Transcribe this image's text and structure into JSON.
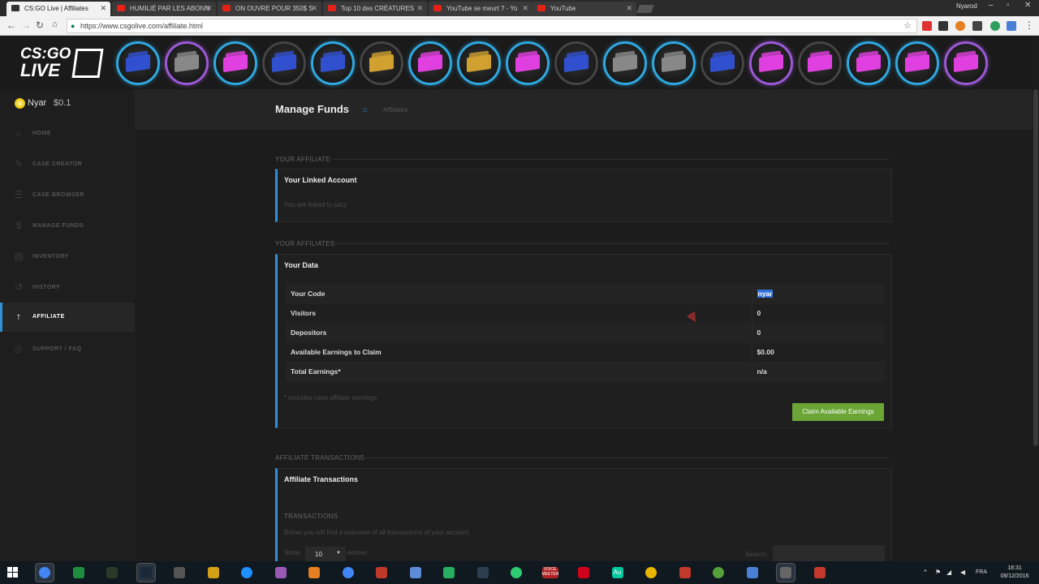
{
  "browser": {
    "tabs": [
      {
        "title": "CS:GO Live | Affiliates",
        "active": true
      },
      {
        "title": "HUMILIÉ PAR LES ABONN",
        "active": false
      },
      {
        "title": "ON OUVRE POUR 350$ S",
        "active": false
      },
      {
        "title": "Top 10 des CRÉATURES",
        "active": false
      },
      {
        "title": "YouTube se meurt ? - Yo",
        "active": false
      },
      {
        "title": "YouTube",
        "active": false
      }
    ],
    "window_user": "Nyarod",
    "url": "https://www.csgolive.com/affiliate.html"
  },
  "site": {
    "logo_line1": "CS:GO",
    "logo_line2": "LIVE",
    "cases": [
      {
        "ring": "blue",
        "color": "#3050d0"
      },
      {
        "ring": "purple",
        "color": "#888888"
      },
      {
        "ring": "blue",
        "color": "#e040e0"
      },
      {
        "ring": "gray",
        "color": "#3050d0"
      },
      {
        "ring": "blue",
        "color": "#3050d0"
      },
      {
        "ring": "gray",
        "color": "#d0a030"
      },
      {
        "ring": "blue",
        "color": "#e040e0"
      },
      {
        "ring": "blue",
        "color": "#d0a030"
      },
      {
        "ring": "blue",
        "color": "#e040e0"
      },
      {
        "ring": "gray",
        "color": "#3050d0"
      },
      {
        "ring": "blue",
        "color": "#888888"
      },
      {
        "ring": "blue",
        "color": "#888888"
      },
      {
        "ring": "gray",
        "color": "#3050d0"
      },
      {
        "ring": "purple",
        "color": "#e040e0"
      },
      {
        "ring": "gray",
        "color": "#e040e0"
      },
      {
        "ring": "blue",
        "color": "#e040e0"
      },
      {
        "ring": "blue",
        "color": "#e040e0"
      },
      {
        "ring": "purple",
        "color": "#e040e0"
      }
    ]
  },
  "sidebar": {
    "user_name": "Nyar",
    "balance": "$0.1",
    "items": [
      {
        "label": "HOME",
        "icon": "home-icon",
        "active": false
      },
      {
        "label": "CASE CREATOR",
        "icon": "edit-icon",
        "active": false
      },
      {
        "label": "CASE BROWSER",
        "icon": "list-icon",
        "active": false
      },
      {
        "label": "MANAGE FUNDS",
        "icon": "dollar-icon",
        "active": false
      },
      {
        "label": "INVENTORY",
        "icon": "inventory-icon",
        "active": false
      },
      {
        "label": "HISTORY",
        "icon": "history-icon",
        "active": false
      },
      {
        "label": "AFFILIATE",
        "icon": "arrow-up-icon",
        "active": true
      },
      {
        "label": "SUPPORT / FAQ",
        "icon": "lifebuoy-icon",
        "active": false
      }
    ]
  },
  "main": {
    "page_title": "Manage Funds",
    "breadcrumb": "Affiliates",
    "your_affiliate": {
      "section_label": "YOUR AFFILIATE",
      "panel_title": "Your Linked Account",
      "linked_text": "You are linked to juicy"
    },
    "your_affiliates": {
      "section_label": "YOUR AFFILIATES",
      "panel_title": "Your Data",
      "rows": [
        {
          "label": "Your Code",
          "value": "nyar"
        },
        {
          "label": "Visitors",
          "value": "0"
        },
        {
          "label": "Depositors",
          "value": "0"
        },
        {
          "label": "Available Earnings to Claim",
          "value": "$0.00"
        },
        {
          "label": "Total Earnings*",
          "value": "n/a"
        }
      ],
      "footnote": "* includes case affiliate earnings",
      "claim_button": "Claim Available Earnings"
    },
    "transactions": {
      "section_label": "AFFILIATE TRANSACTIONS",
      "panel_title": "Affiliate Transactions",
      "sub_label": "TRANSACTIONS",
      "description": "Below you will find a overview of all transactions of your account.",
      "show_label": "Show",
      "show_value": "10",
      "entries_label": "entries",
      "search_label": "Search:"
    }
  },
  "taskbar": {
    "apps": [
      "chrome",
      "excel",
      "gta",
      "steam",
      "witcher",
      "star",
      "edge",
      "photo",
      "books",
      "google",
      "lastpass",
      "notepad",
      "colors",
      "mumble",
      "xbox",
      "voicemeeter",
      "creative-cloud",
      "audition",
      "obs",
      "x",
      "utorrent",
      "docs",
      "display",
      "aa"
    ],
    "voicemeeter_label": "VOICE MEETER",
    "audition_label": "Au",
    "lang": "FRA",
    "time": "18:31",
    "date": "08/12/2016"
  },
  "colors": {
    "accent": "#2f8fd8",
    "claim_green": "#6aa536",
    "background": "#1c1c1c"
  }
}
